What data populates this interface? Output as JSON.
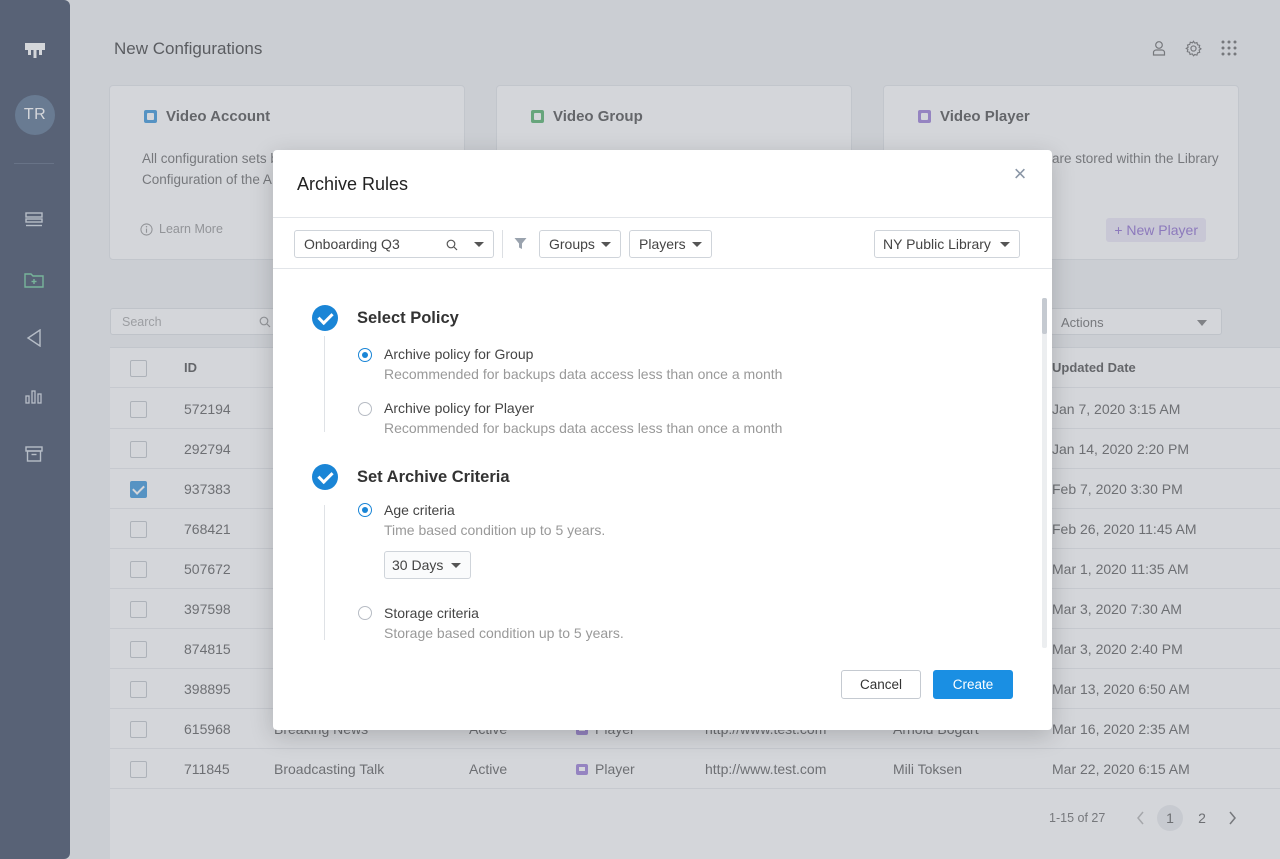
{
  "page": {
    "title": "New Configurations"
  },
  "sidebar": {
    "avatar_initials": "TR"
  },
  "cards": [
    {
      "title": "Video Account",
      "desc": "All configuration sets belong to the Account level. Configuration of the A",
      "link": "Learn More",
      "color": "#1a85d6"
    },
    {
      "title": "Video Group",
      "desc": "",
      "color": "#3aa655"
    },
    {
      "title": "Video Player",
      "desc": "are stored within the Library",
      "button": "+ New Player",
      "color": "#8c6ad2"
    }
  ],
  "table": {
    "search_placeholder": "Search",
    "actions_label": "Actions",
    "headers": {
      "id": "ID",
      "updated": "Updated Date"
    },
    "rows": [
      {
        "id": "572194",
        "date": "Jan 7, 2020 3:15 AM",
        "checked": false
      },
      {
        "id": "292794",
        "date": "Jan 14, 2020 2:20 PM",
        "checked": false
      },
      {
        "id": "937383",
        "date": "Feb 7, 2020 3:30 PM",
        "checked": true
      },
      {
        "id": "768421",
        "date": "Feb 26, 2020 11:45 AM",
        "checked": false
      },
      {
        "id": "507672",
        "date": "Mar 1, 2020 11:35 AM",
        "checked": false
      },
      {
        "id": "397598",
        "date": "Mar 3, 2020 7:30 AM",
        "checked": false
      },
      {
        "id": "874815",
        "date": "Mar 3, 2020 2:40 PM",
        "checked": false
      },
      {
        "id": "398895",
        "date": "Mar 13, 2020 6:50 AM",
        "checked": false
      },
      {
        "id": "615968",
        "name": "Breaking News",
        "status": "Active",
        "type": "Player",
        "url": "http://www.test.com",
        "owner": "Arnold Bogart",
        "date": "Mar 16, 2020 2:35 AM",
        "checked": false
      },
      {
        "id": "711845",
        "name": "Broadcasting Talk",
        "status": "Active",
        "type": "Player",
        "url": "http://www.test.com",
        "owner": "Mili Toksen",
        "date": "Mar 22, 2020 6:15 AM",
        "checked": false
      }
    ],
    "pager": {
      "range": "1-15 of 27",
      "pages": [
        "1",
        "2"
      ]
    }
  },
  "modal": {
    "title": "Archive Rules",
    "close": "×",
    "toolbar": {
      "project": "Onboarding Q3",
      "groups": "Groups",
      "players": "Players",
      "library": "NY Public Library"
    },
    "steps": [
      {
        "title": "Select Policy",
        "options": [
          {
            "label": "Archive policy for Group",
            "sub": "Recommended for backups data access less than once a month",
            "selected": true
          },
          {
            "label": "Archive policy for Player",
            "sub": "Recommended for backups data access less than once a month",
            "selected": false
          }
        ]
      },
      {
        "title": "Set Archive Criteria",
        "options": [
          {
            "label": "Age criteria",
            "sub": "Time based condition up to 5 years.",
            "selected": true,
            "dropdown": "30 Days"
          },
          {
            "label": "Storage criteria",
            "sub": "Storage based condition up to 5 years.",
            "selected": false
          }
        ]
      }
    ],
    "cancel": "Cancel",
    "create": "Create"
  }
}
